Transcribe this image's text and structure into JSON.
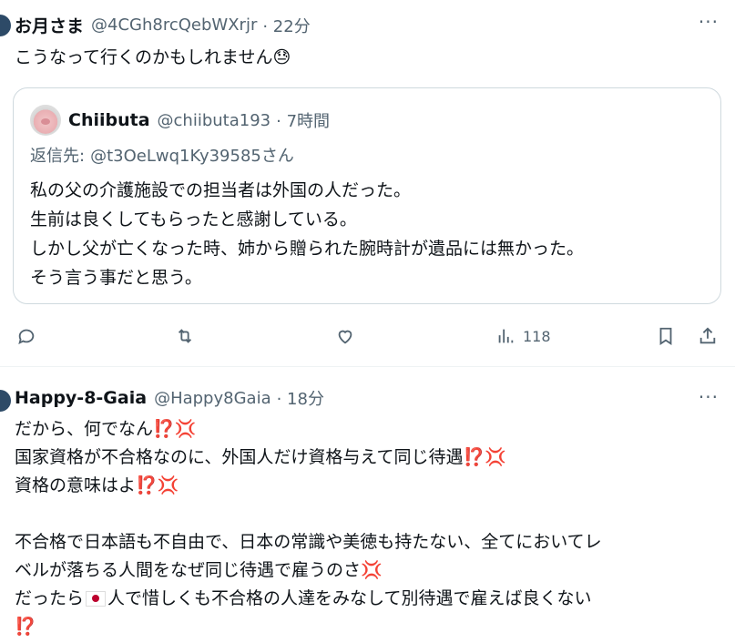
{
  "tweet1": {
    "name": "お月さま",
    "handle": "@4CGh8rcQebWXrjr",
    "time": "· 22分",
    "text": "こうなって行くのかもしれません😓",
    "more": "···"
  },
  "quote": {
    "name": "Chiibuta",
    "handle": "@chiibuta193",
    "time": "· 7時間",
    "reply_prefix": "返信先:",
    "reply_to": "@t3OeLwq1Ky39585さん",
    "lines": [
      "私の父の介護施設での担当者は外国の人だった。",
      "生前は良くしてもらったと感謝している。",
      "しかし父が亡くなった時、姉から贈られた腕時計が遺品には無かった。",
      "そう言う事だと思う。"
    ]
  },
  "actions": {
    "views": "118"
  },
  "tweet2": {
    "name": "Happy-8-Gaia",
    "handle": "@Happy8Gaia",
    "time": "· 18分",
    "more": "···",
    "line1": "だから、何でなん",
    "line2": "国家資格が不合格なのに、外国人だけ資格与えて同じ待遇",
    "line3": "資格の意味はよ",
    "line5": "不合格で日本語も不自由で、日本の常識や美徳も持たない、全てにおいてレ",
    "line6": "ベルが落ちる人間をなぜ同じ待遇で雇うのさ",
    "line7a": "だったら",
    "line7b": "人で惜しくも不合格の人達をみなして別待遇で雇えば良くない",
    "emoji_ex": "⁉️",
    "emoji_anger": "💢"
  },
  "colors": {
    "muted": "#536471",
    "border": "#cfd9de",
    "alert": "#be1931"
  }
}
